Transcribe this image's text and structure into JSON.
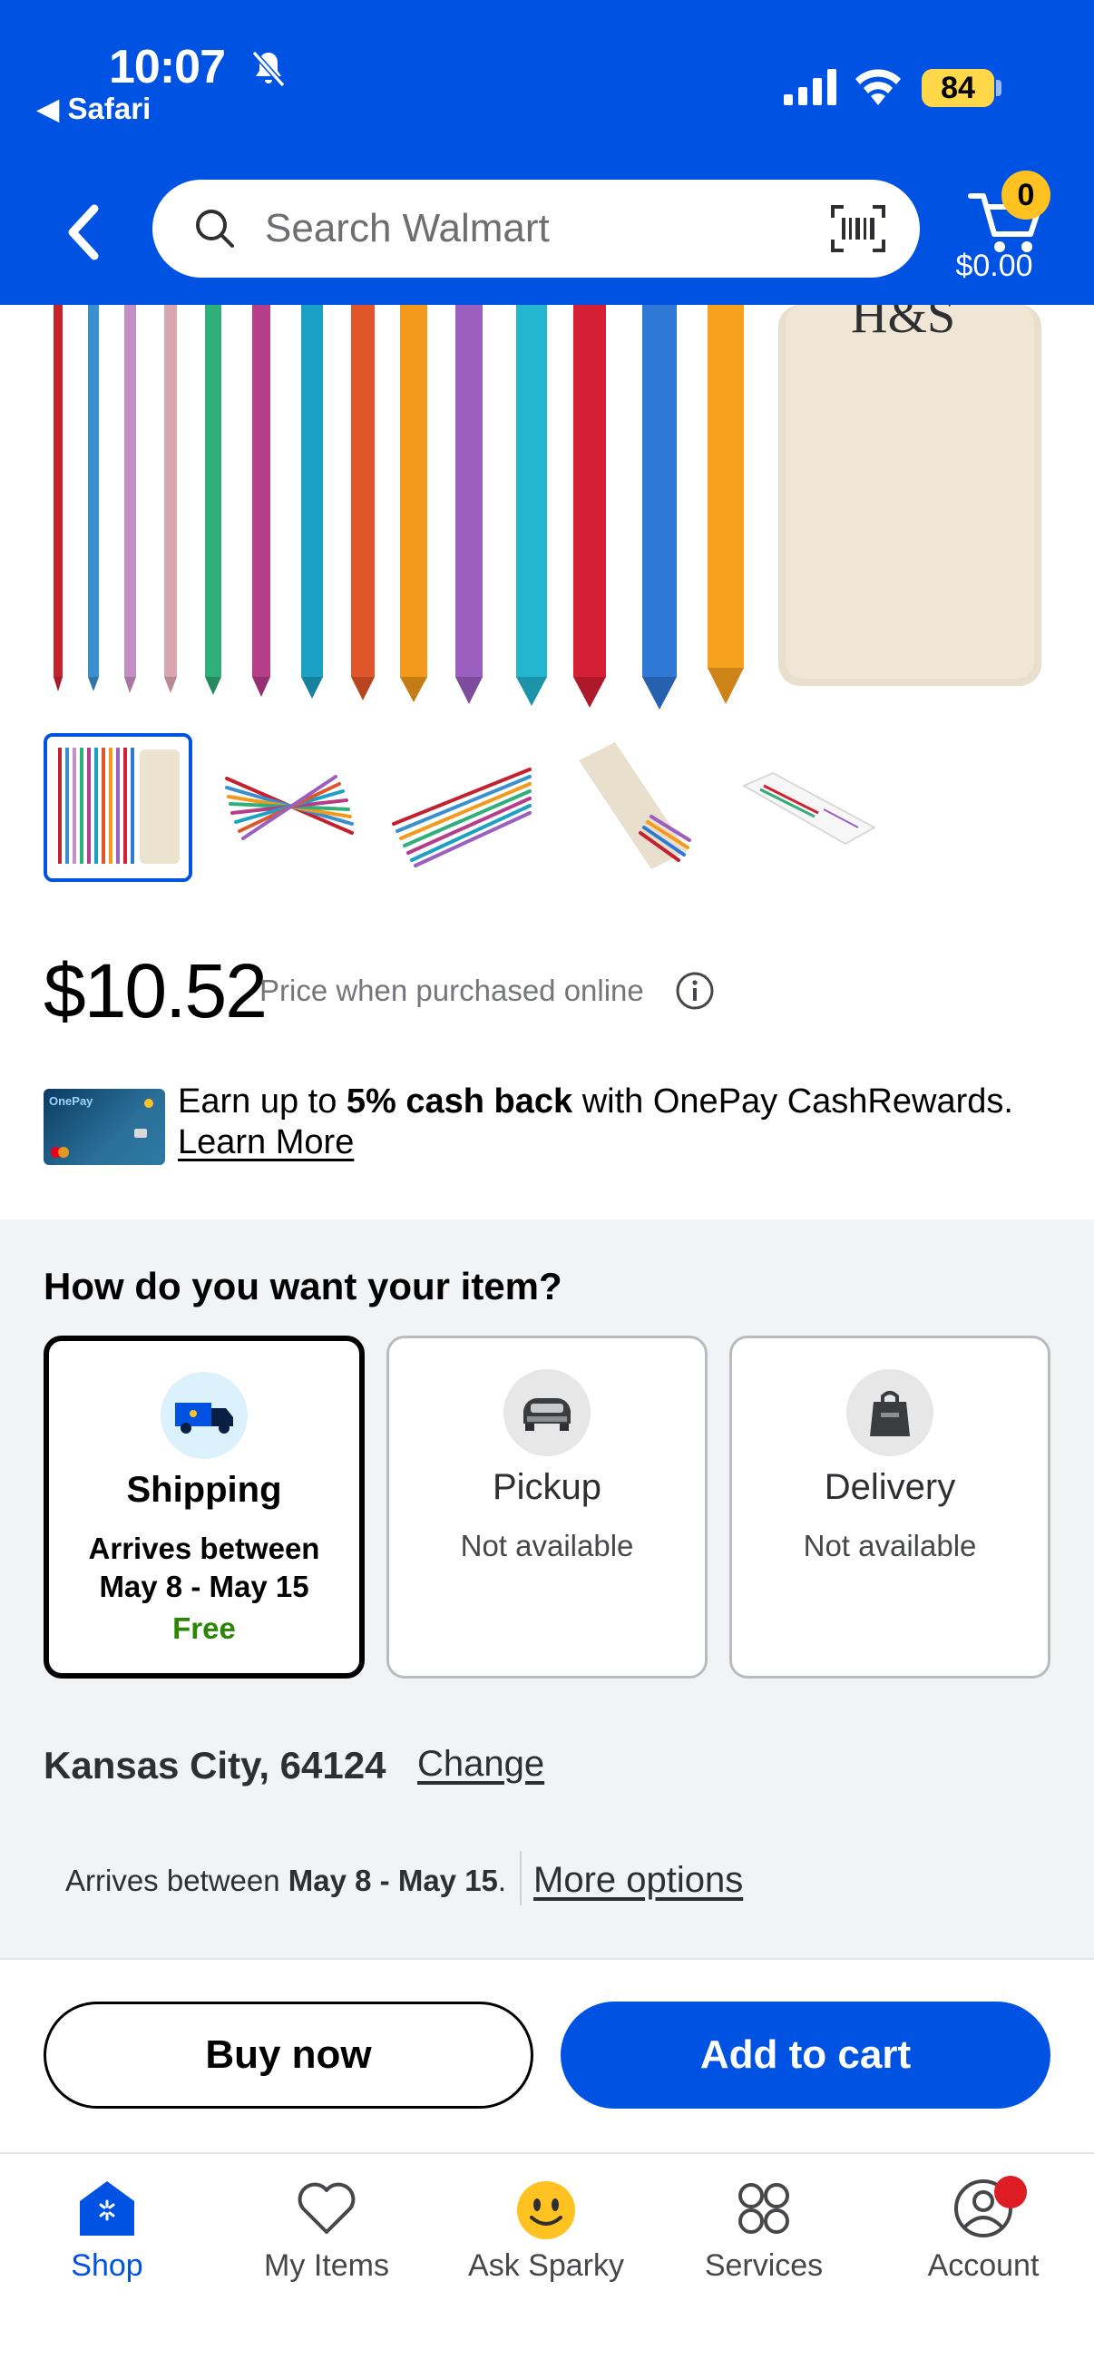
{
  "status_bar": {
    "time": "10:07",
    "back_app": "◀ Safari",
    "battery": "84"
  },
  "header": {
    "search_placeholder": "Search Walmart",
    "cart_count": "0",
    "cart_total": "$0.00",
    "brand_color": "#0053e2"
  },
  "product": {
    "price": "$10.52",
    "price_note": "Price when purchased online",
    "image_icon": "crochet-hooks-photo",
    "thumbnail_count": 5
  },
  "onepay": {
    "prefix": "Earn up to ",
    "highlight": "5% cash back",
    "suffix": " with OnePay CashRewards.",
    "learn_more": "Learn More"
  },
  "fulfillment": {
    "title": "How do you want your item?",
    "options": [
      {
        "title": "Shipping",
        "subtitle_line1": "Arrives between",
        "subtitle_line2": "May 8 - May 15",
        "price": "Free",
        "icon": "shipping-truck-icon"
      },
      {
        "title": "Pickup",
        "subtitle_line1": "Not available",
        "icon": "pickup-car-icon"
      },
      {
        "title": "Delivery",
        "subtitle_line1": "Not available",
        "icon": "delivery-bag-icon"
      }
    ],
    "location": "Kansas City, 64124",
    "change": "Change",
    "arrives_prefix": "Arrives between ",
    "arrives_dates": "May 8 - May 15",
    "arrives_suffix": ".",
    "more_options": "More options"
  },
  "actions": {
    "buy_now": "Buy now",
    "add_to_cart": "Add to cart"
  },
  "tabbar": {
    "items": [
      {
        "label": "Shop",
        "icon": "shop-icon",
        "active": true
      },
      {
        "label": "My Items",
        "icon": "heart-icon"
      },
      {
        "label": "Ask Sparky",
        "icon": "sparky-icon"
      },
      {
        "label": "Services",
        "icon": "services-grid-icon"
      },
      {
        "label": "Account",
        "icon": "account-icon"
      }
    ]
  }
}
